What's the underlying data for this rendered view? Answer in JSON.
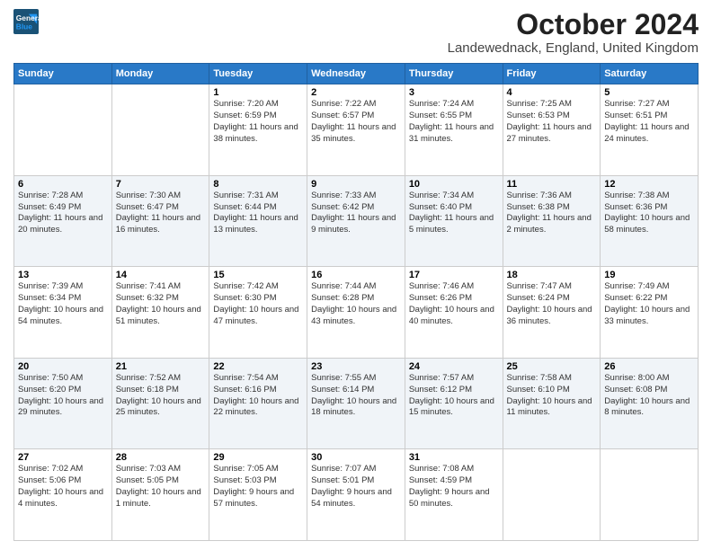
{
  "logo": {
    "line1": "General",
    "line2": "Blue"
  },
  "title": "October 2024",
  "location": "Landewednack, England, United Kingdom",
  "weekdays": [
    "Sunday",
    "Monday",
    "Tuesday",
    "Wednesday",
    "Thursday",
    "Friday",
    "Saturday"
  ],
  "weeks": [
    [
      {
        "day": "",
        "info": ""
      },
      {
        "day": "",
        "info": ""
      },
      {
        "day": "1",
        "info": "Sunrise: 7:20 AM\nSunset: 6:59 PM\nDaylight: 11 hours and 38 minutes."
      },
      {
        "day": "2",
        "info": "Sunrise: 7:22 AM\nSunset: 6:57 PM\nDaylight: 11 hours and 35 minutes."
      },
      {
        "day": "3",
        "info": "Sunrise: 7:24 AM\nSunset: 6:55 PM\nDaylight: 11 hours and 31 minutes."
      },
      {
        "day": "4",
        "info": "Sunrise: 7:25 AM\nSunset: 6:53 PM\nDaylight: 11 hours and 27 minutes."
      },
      {
        "day": "5",
        "info": "Sunrise: 7:27 AM\nSunset: 6:51 PM\nDaylight: 11 hours and 24 minutes."
      }
    ],
    [
      {
        "day": "6",
        "info": "Sunrise: 7:28 AM\nSunset: 6:49 PM\nDaylight: 11 hours and 20 minutes."
      },
      {
        "day": "7",
        "info": "Sunrise: 7:30 AM\nSunset: 6:47 PM\nDaylight: 11 hours and 16 minutes."
      },
      {
        "day": "8",
        "info": "Sunrise: 7:31 AM\nSunset: 6:44 PM\nDaylight: 11 hours and 13 minutes."
      },
      {
        "day": "9",
        "info": "Sunrise: 7:33 AM\nSunset: 6:42 PM\nDaylight: 11 hours and 9 minutes."
      },
      {
        "day": "10",
        "info": "Sunrise: 7:34 AM\nSunset: 6:40 PM\nDaylight: 11 hours and 5 minutes."
      },
      {
        "day": "11",
        "info": "Sunrise: 7:36 AM\nSunset: 6:38 PM\nDaylight: 11 hours and 2 minutes."
      },
      {
        "day": "12",
        "info": "Sunrise: 7:38 AM\nSunset: 6:36 PM\nDaylight: 10 hours and 58 minutes."
      }
    ],
    [
      {
        "day": "13",
        "info": "Sunrise: 7:39 AM\nSunset: 6:34 PM\nDaylight: 10 hours and 54 minutes."
      },
      {
        "day": "14",
        "info": "Sunrise: 7:41 AM\nSunset: 6:32 PM\nDaylight: 10 hours and 51 minutes."
      },
      {
        "day": "15",
        "info": "Sunrise: 7:42 AM\nSunset: 6:30 PM\nDaylight: 10 hours and 47 minutes."
      },
      {
        "day": "16",
        "info": "Sunrise: 7:44 AM\nSunset: 6:28 PM\nDaylight: 10 hours and 43 minutes."
      },
      {
        "day": "17",
        "info": "Sunrise: 7:46 AM\nSunset: 6:26 PM\nDaylight: 10 hours and 40 minutes."
      },
      {
        "day": "18",
        "info": "Sunrise: 7:47 AM\nSunset: 6:24 PM\nDaylight: 10 hours and 36 minutes."
      },
      {
        "day": "19",
        "info": "Sunrise: 7:49 AM\nSunset: 6:22 PM\nDaylight: 10 hours and 33 minutes."
      }
    ],
    [
      {
        "day": "20",
        "info": "Sunrise: 7:50 AM\nSunset: 6:20 PM\nDaylight: 10 hours and 29 minutes."
      },
      {
        "day": "21",
        "info": "Sunrise: 7:52 AM\nSunset: 6:18 PM\nDaylight: 10 hours and 25 minutes."
      },
      {
        "day": "22",
        "info": "Sunrise: 7:54 AM\nSunset: 6:16 PM\nDaylight: 10 hours and 22 minutes."
      },
      {
        "day": "23",
        "info": "Sunrise: 7:55 AM\nSunset: 6:14 PM\nDaylight: 10 hours and 18 minutes."
      },
      {
        "day": "24",
        "info": "Sunrise: 7:57 AM\nSunset: 6:12 PM\nDaylight: 10 hours and 15 minutes."
      },
      {
        "day": "25",
        "info": "Sunrise: 7:58 AM\nSunset: 6:10 PM\nDaylight: 10 hours and 11 minutes."
      },
      {
        "day": "26",
        "info": "Sunrise: 8:00 AM\nSunset: 6:08 PM\nDaylight: 10 hours and 8 minutes."
      }
    ],
    [
      {
        "day": "27",
        "info": "Sunrise: 7:02 AM\nSunset: 5:06 PM\nDaylight: 10 hours and 4 minutes."
      },
      {
        "day": "28",
        "info": "Sunrise: 7:03 AM\nSunset: 5:05 PM\nDaylight: 10 hours and 1 minute."
      },
      {
        "day": "29",
        "info": "Sunrise: 7:05 AM\nSunset: 5:03 PM\nDaylight: 9 hours and 57 minutes."
      },
      {
        "day": "30",
        "info": "Sunrise: 7:07 AM\nSunset: 5:01 PM\nDaylight: 9 hours and 54 minutes."
      },
      {
        "day": "31",
        "info": "Sunrise: 7:08 AM\nSunset: 4:59 PM\nDaylight: 9 hours and 50 minutes."
      },
      {
        "day": "",
        "info": ""
      },
      {
        "day": "",
        "info": ""
      }
    ]
  ]
}
